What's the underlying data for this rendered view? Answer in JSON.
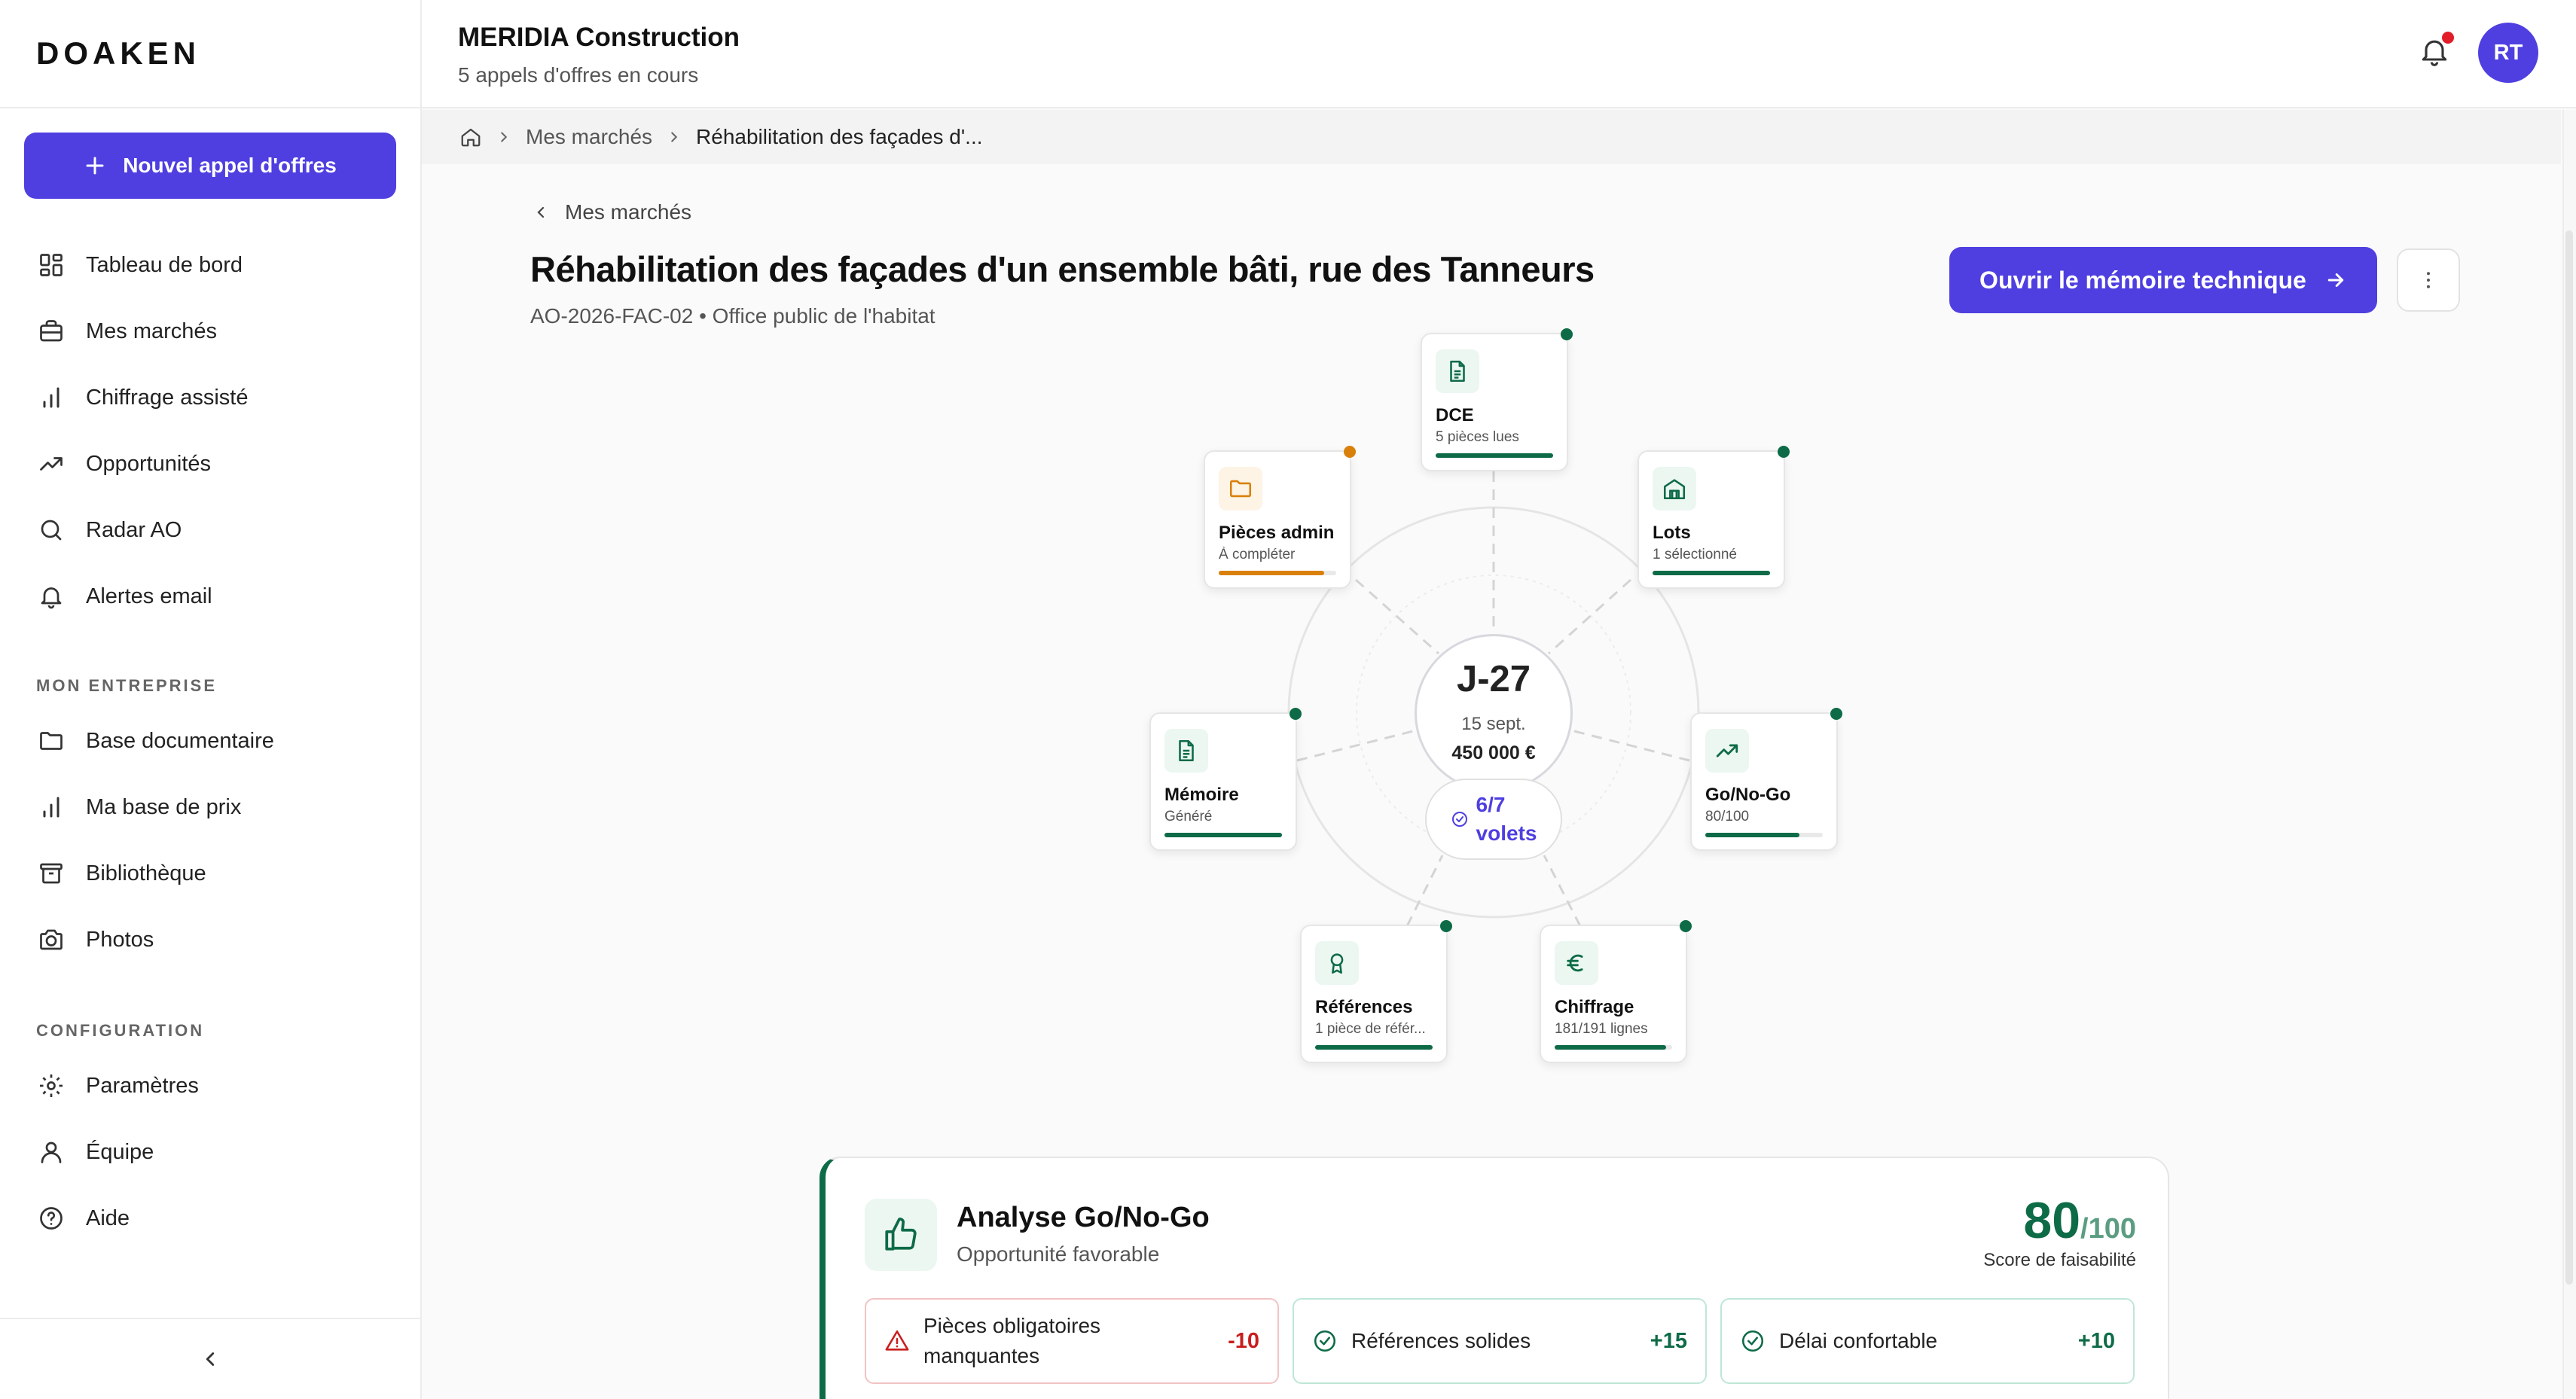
{
  "brand": {
    "logo": "DOAKEN",
    "accent": "#4f3fe0",
    "success": "#0e6b47",
    "warning": "#d9800b",
    "danger": "#c81e1e"
  },
  "sidebar": {
    "new_button": "Nouvel appel d'offres",
    "items": [
      {
        "label": "Tableau de bord",
        "icon": "dashboard-icon"
      },
      {
        "label": "Mes marchés",
        "icon": "briefcase-icon"
      },
      {
        "label": "Chiffrage assisté",
        "icon": "bar-chart-icon"
      },
      {
        "label": "Opportunités",
        "icon": "trending-up-icon"
      },
      {
        "label": "Radar AO",
        "icon": "search-icon"
      },
      {
        "label": "Alertes email",
        "icon": "bell-icon"
      }
    ],
    "section_company": "MON ENTREPRISE",
    "company_items": [
      {
        "label": "Base documentaire",
        "icon": "folder-icon"
      },
      {
        "label": "Ma base de prix",
        "icon": "bar-chart-icon"
      },
      {
        "label": "Bibliothèque",
        "icon": "archive-icon"
      },
      {
        "label": "Photos",
        "icon": "camera-icon"
      }
    ],
    "section_config": "CONFIGURATION",
    "config_items": [
      {
        "label": "Paramètres",
        "icon": "gear-icon"
      },
      {
        "label": "Équipe",
        "icon": "user-icon"
      },
      {
        "label": "Aide",
        "icon": "help-icon"
      }
    ]
  },
  "header": {
    "company": "MERIDIA Construction",
    "subtitle": "5 appels d'offres en cours",
    "avatar": "RT"
  },
  "breadcrumb": {
    "level1": "Mes marchés",
    "current": "Réhabilitation des façades d'..."
  },
  "page": {
    "back_label": "Mes marchés",
    "title": "Réhabilitation des façades d'un ensemble bâti, rue des Tanneurs",
    "reference": "AO-2026-FAC-02 • Office public de l'habitat",
    "open_button": "Ouvrir le mémoire technique"
  },
  "orbit": {
    "center": {
      "countdown": "J-27",
      "date": "15 sept.",
      "amount": "450 000 €"
    },
    "progress": {
      "line1": "6/7",
      "line2": "volets"
    },
    "nodes": {
      "dce": {
        "label": "DCE",
        "sub": "5 pièces lues",
        "progress": 1.0,
        "status": "ok"
      },
      "lots": {
        "label": "Lots",
        "sub": "1 sélectionné",
        "progress": 1.0,
        "status": "ok"
      },
      "gonogo": {
        "label": "Go/No-Go",
        "sub": "80/100",
        "progress": 0.8,
        "status": "ok"
      },
      "chiffrage": {
        "label": "Chiffrage",
        "sub": "181/191 lignes",
        "progress": 0.95,
        "status": "ok"
      },
      "references": {
        "label": "Références",
        "sub": "1 pièce de référ...",
        "progress": 1.0,
        "status": "ok"
      },
      "memoire": {
        "label": "Mémoire",
        "sub": "Généré",
        "progress": 1.0,
        "status": "ok"
      },
      "admin": {
        "label": "Pièces admin",
        "sub": "À compléter",
        "progress": 0.9,
        "status": "warning"
      }
    }
  },
  "gonogo": {
    "title": "Analyse Go/No-Go",
    "subtitle": "Opportunité favorable",
    "score": "80",
    "score_max": "/100",
    "score_label": "Score de faisabilité",
    "factors": [
      {
        "label": "Pièces obligatoires manquantes",
        "value": "-10",
        "type": "neg"
      },
      {
        "label": "Références solides",
        "value": "+15",
        "type": "pos"
      },
      {
        "label": "Délai confortable",
        "value": "+10",
        "type": "pos"
      }
    ]
  }
}
